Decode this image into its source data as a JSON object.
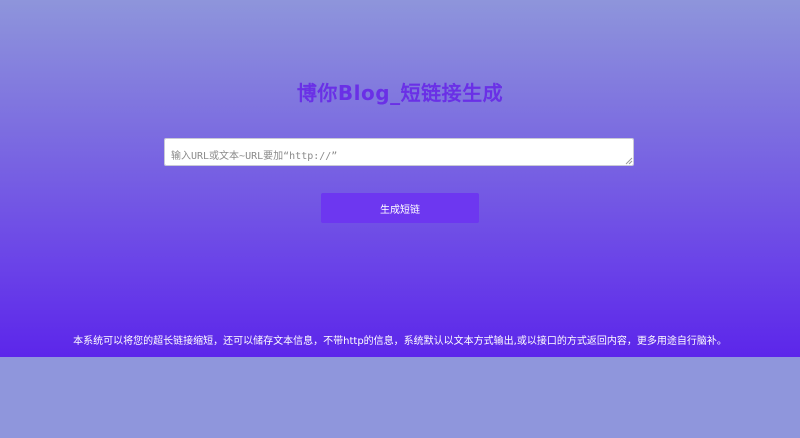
{
  "page": {
    "title": "博你Blog_短链接生成"
  },
  "form": {
    "input_placeholder": "输入URL或文本~URL要加“http://”",
    "input_value": "",
    "submit_label": "生成短链"
  },
  "footer": {
    "description": "本系统可以将您的超长链接缩短，还可以储存文本信息，不带http的信息，系统默认以文本方式输出,或以接口的方式返回内容，更多用途自行脑补。"
  },
  "colors": {
    "title": "#6a30e6",
    "button": "#6d37f0",
    "gradient_top": "#8e95db",
    "gradient_bottom": "#5c26ea"
  }
}
